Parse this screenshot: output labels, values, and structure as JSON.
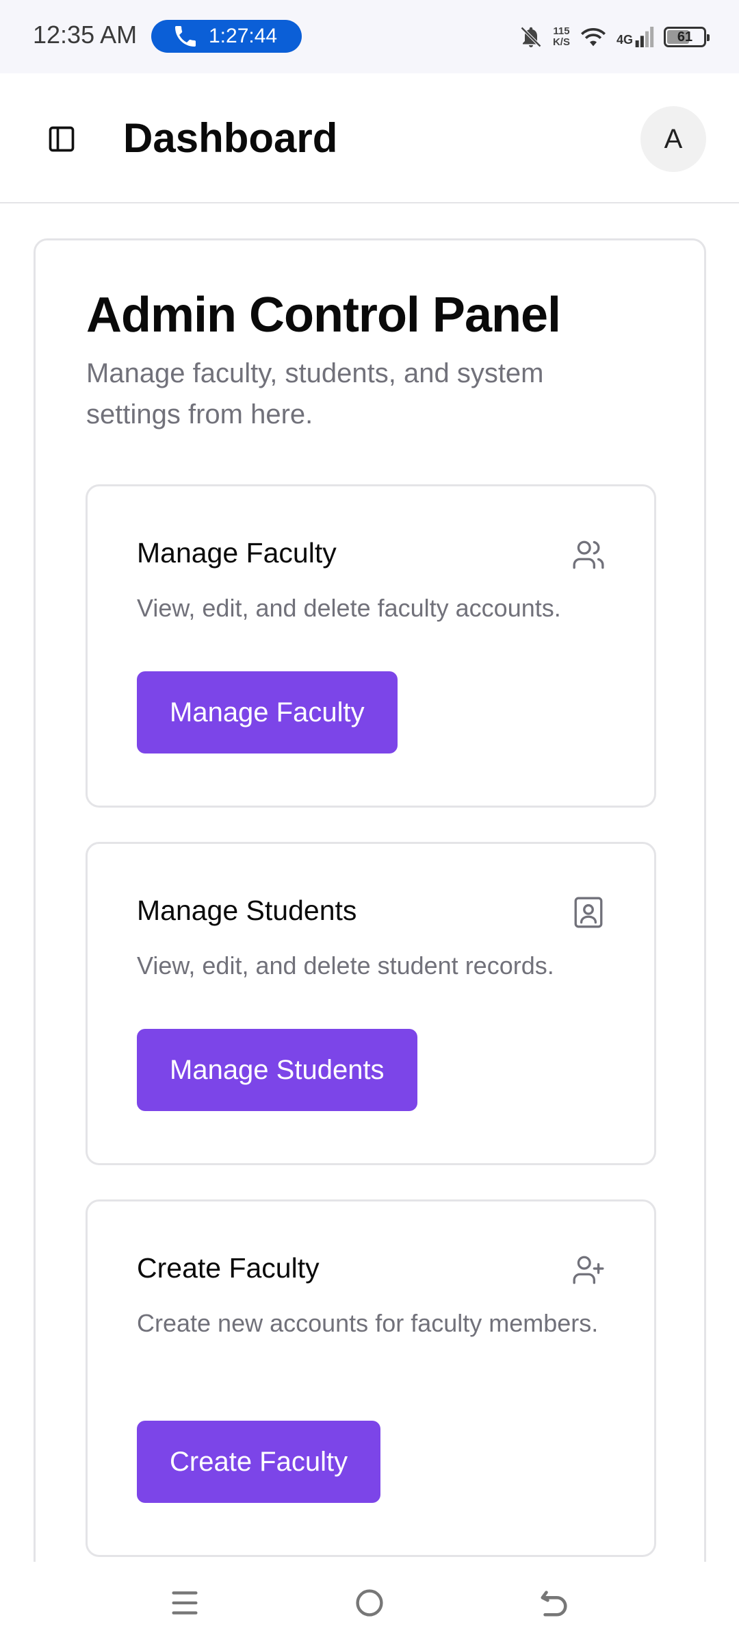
{
  "status_bar": {
    "time": "12:35 AM",
    "call_timer": "1:27:44",
    "net_speed_value": "115",
    "net_speed_unit": "K/S",
    "network_type": "4G",
    "battery_level": "61",
    "call_pill_color": "#0b5fd7"
  },
  "header": {
    "title": "Dashboard",
    "avatar_initial": "A",
    "sidebar_icon": "panel-left-icon"
  },
  "panel": {
    "title": "Admin Control Panel",
    "description": "Manage faculty, students, and system settings from here."
  },
  "cards": [
    {
      "title": "Manage Faculty",
      "description": "View, edit, and delete faculty accounts.",
      "button_label": "Manage Faculty",
      "icon": "users-icon"
    },
    {
      "title": "Manage Students",
      "description": "View, edit, and delete student records.",
      "button_label": "Manage Students",
      "icon": "contact-book-icon"
    },
    {
      "title": "Create Faculty",
      "description": "Create new accounts for faculty members.",
      "button_label": "Create Faculty",
      "icon": "user-plus-icon"
    }
  ],
  "colors": {
    "accent": "#7c45e8",
    "muted_text": "#71717a",
    "border": "#e4e4e7"
  },
  "nav": {
    "menu_icon": "menu-icon",
    "home_icon": "home-circle-icon",
    "back_icon": "back-icon"
  }
}
